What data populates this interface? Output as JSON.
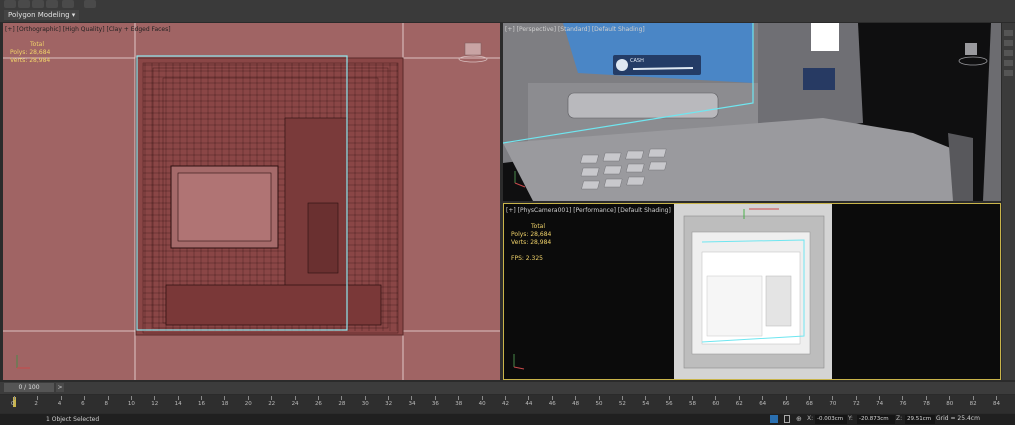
{
  "toolbar": {
    "mode_label": "Polygon Modeling ▾"
  },
  "viewports": {
    "left_label": "[+] [Orthographic] [High Quality] [Clay + Edged Faces]",
    "left_stats": {
      "title": "Total",
      "polys": "Polys:   28,684",
      "verts": "Verts:   28,984"
    },
    "persp_label": "[+] [Perspective] [Standard] [Default Shading]",
    "persp_screen_text": "CASH",
    "camera_label": "[+] [PhysCamera001] [Performance] [Default Shading]",
    "camera_stats": {
      "title": "Total",
      "polys": "Polys:   28,684",
      "verts": "Verts:   28,984",
      "fps": "FPS:     2.325"
    }
  },
  "timeline": {
    "frame_display": "0 / 100",
    "next_label": ">",
    "ticks": [
      "0",
      "2",
      "4",
      "6",
      "8",
      "10",
      "12",
      "14",
      "16",
      "18",
      "20",
      "22",
      "24",
      "26",
      "28",
      "30",
      "32",
      "34",
      "36",
      "38",
      "40",
      "42",
      "44",
      "46",
      "48",
      "50",
      "52",
      "54",
      "56",
      "58",
      "60",
      "62",
      "64",
      "66",
      "68",
      "70",
      "72",
      "74",
      "76",
      "78",
      "80",
      "82",
      "84"
    ]
  },
  "status": {
    "selection_text": "1 Object Selected",
    "x_label": "X:",
    "x_value": "-0.003cm",
    "y_label": "Y:",
    "y_value": "-20.873cm",
    "z_label": "Z:",
    "z_value": "29.51cm",
    "grid": "Grid = 25.4cm"
  }
}
